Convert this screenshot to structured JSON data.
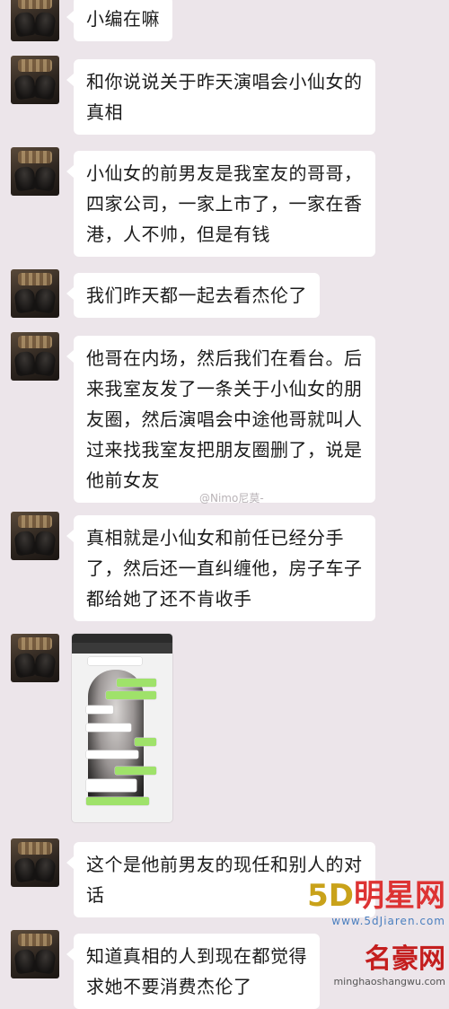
{
  "messages": [
    {
      "lines": [
        "小编在嘛"
      ]
    },
    {
      "lines": [
        "和你说说关于昨天演唱会小仙女的",
        "真相"
      ]
    },
    {
      "lines": [
        "小仙女的前男友是我室友的哥哥，",
        "四家公司，一家上市了，一家在香",
        "港，人不帅，但是有钱"
      ]
    },
    {
      "lines": [
        "我们昨天都一起去看杰伦了"
      ]
    },
    {
      "lines": [
        "他哥在内场，然后我们在看台。后",
        "来我室友发了一条关于小仙女的朋",
        "友圈，然后演唱会中途他哥就叫人",
        "过来找我室友把朋友圈删了，说是",
        "他前女友"
      ]
    },
    {
      "lines": [
        "真相就是小仙女和前任已经分手",
        "了，然后还一直纠缠他，房子车子",
        "都给她了还不肯收手"
      ]
    },
    {
      "lines": [
        "这个是他前男友的现任和别人的对",
        "话"
      ]
    },
    {
      "lines": [
        "知道真相的人到现在都觉得",
        "求她不要消费杰伦了"
      ]
    }
  ],
  "weibo_watermark": "@Nimo尼莫-",
  "site_watermark_1": {
    "brand_5d": "5D",
    "brand_name": "明星网",
    "url": "www.5dJiaren.com"
  },
  "site_watermark_2": {
    "brand_name": "名豪网",
    "url": "minghaoshangwu.com"
  }
}
